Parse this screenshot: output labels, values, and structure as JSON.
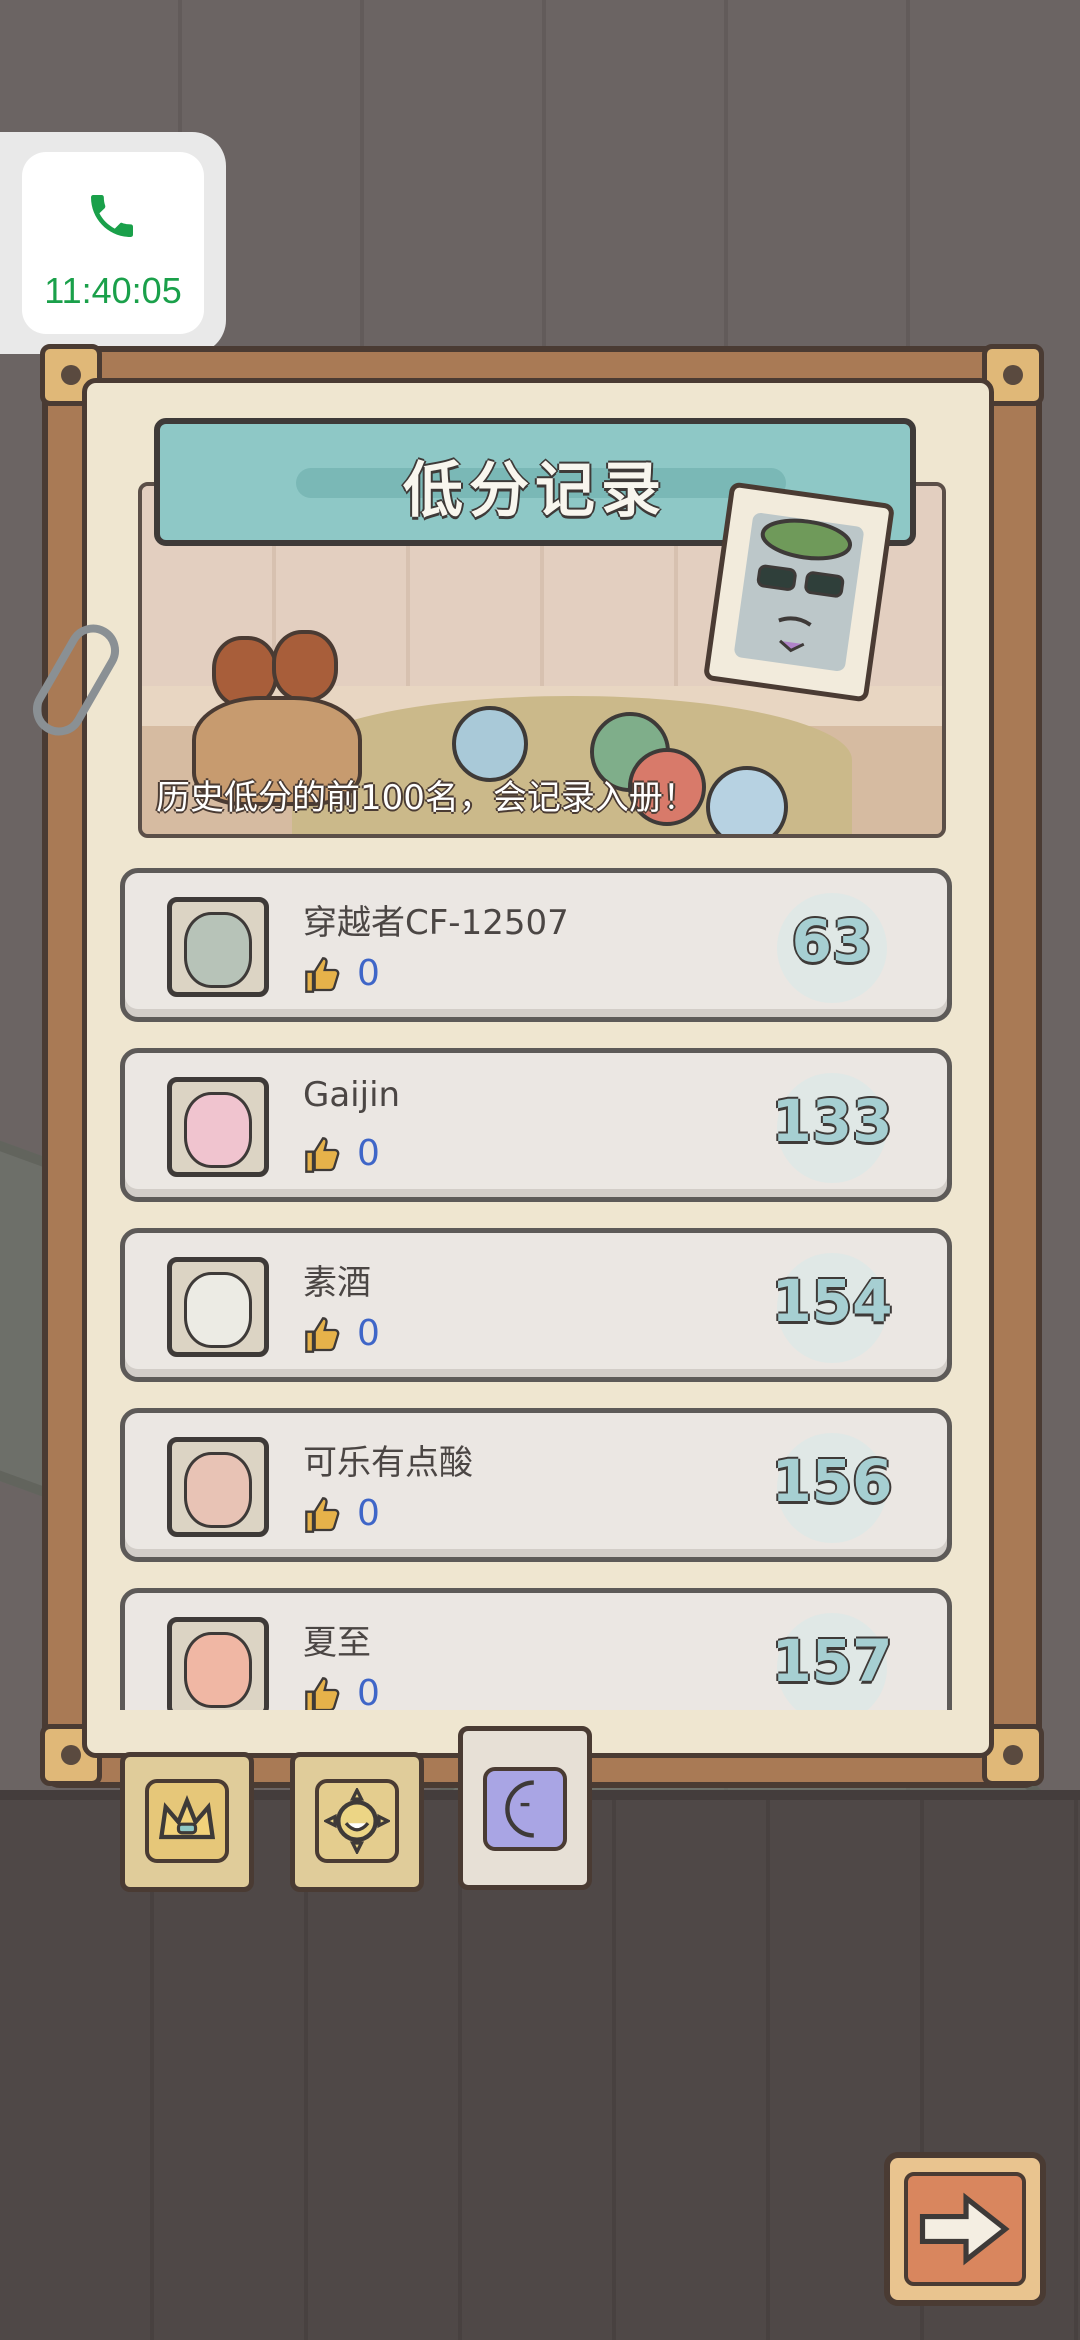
{
  "status": {
    "call_time": "11:40:05"
  },
  "header": {
    "title": "低分记录",
    "caption": "历史低分的前100名，会记录入册！"
  },
  "ranking": [
    {
      "name": "穿越者CF-12507",
      "likes": "0",
      "score": "63",
      "avatar": "sunglasses-snail-avatar"
    },
    {
      "name": "Gaijin",
      "likes": "0",
      "score": "133",
      "avatar": "pink-snail-avatar"
    },
    {
      "name": "素酒",
      "likes": "0",
      "score": "154",
      "avatar": "angel-snail-avatar"
    },
    {
      "name": "可乐有点酸",
      "likes": "0",
      "score": "156",
      "avatar": "shell-snail-avatar"
    },
    {
      "name": "夏至",
      "likes": "0",
      "score": "157",
      "avatar": "muscle-man-avatar"
    }
  ],
  "tabs": [
    {
      "name": "crown-tab",
      "icon": "crown-icon",
      "active": false
    },
    {
      "name": "sun-tab",
      "icon": "sun-face-icon",
      "active": false
    },
    {
      "name": "moon-tab",
      "icon": "moon-face-icon",
      "active": true
    }
  ],
  "colors": {
    "banner": "#8ec8c6",
    "score_text": "#a6cfd2",
    "like_count": "#3f66c8",
    "call_green": "#1aa04a"
  }
}
